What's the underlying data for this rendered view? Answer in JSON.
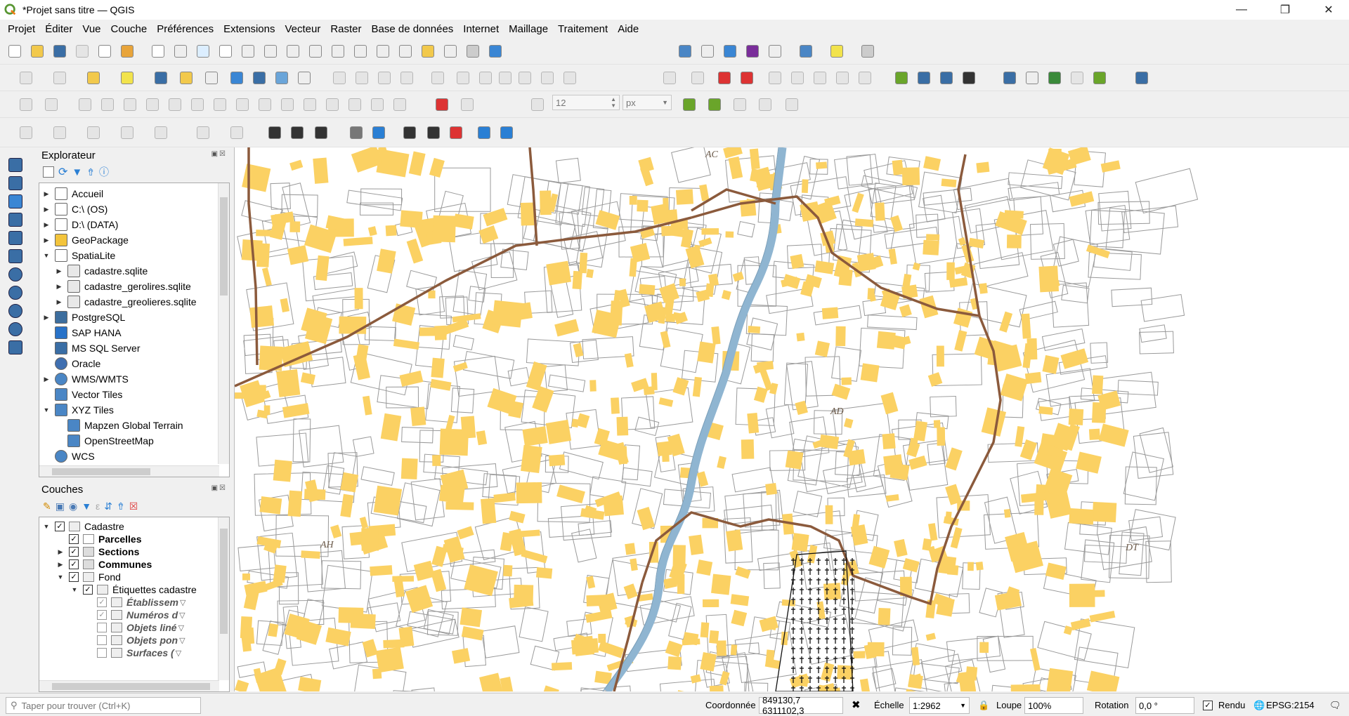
{
  "window": {
    "title": "*Projet sans titre — QGIS",
    "controls": [
      "minimize-icon",
      "maximize-icon",
      "close-icon"
    ]
  },
  "menu": [
    {
      "label": "Projet",
      "u": "P"
    },
    {
      "label": "Éditer",
      "u": "É"
    },
    {
      "label": "Vue",
      "u": "V"
    },
    {
      "label": "Couche",
      "u": "C"
    },
    {
      "label": "Préférences",
      "u": "P"
    },
    {
      "label": "Extensions",
      "u": "E"
    },
    {
      "label": "Vecteur",
      "u": "V"
    },
    {
      "label": "Raster",
      "u": "R"
    },
    {
      "label": "Base de données",
      "u": "B"
    },
    {
      "label": "Internet",
      "u": "I"
    },
    {
      "label": "Maillage",
      "u": "M"
    },
    {
      "label": "Traitement",
      "u": "T"
    },
    {
      "label": "Aide",
      "u": "A"
    }
  ],
  "snapping": {
    "tolerance": "12",
    "units": "px"
  },
  "explorer": {
    "title": "Explorateur",
    "items": [
      {
        "label": "Accueil",
        "icon": "home-icon",
        "expand": "right"
      },
      {
        "label": "C:\\ (OS)",
        "icon": "folder-icon",
        "expand": "right"
      },
      {
        "label": "D:\\ (DATA)",
        "icon": "folder-icon",
        "expand": "right"
      },
      {
        "label": "GeoPackage",
        "icon": "geopackage-icon",
        "expand": "right"
      },
      {
        "label": "SpatiaLite",
        "icon": "spatialite-icon",
        "expand": "down"
      },
      {
        "label": "cadastre.sqlite",
        "icon": "database-icon",
        "expand": "right",
        "child": true
      },
      {
        "label": "cadastre_gerolires.sqlite",
        "icon": "database-icon",
        "expand": "right",
        "child": true
      },
      {
        "label": "cadastre_greolieres.sqlite",
        "icon": "database-icon",
        "expand": "right",
        "child": true
      },
      {
        "label": "PostgreSQL",
        "icon": "postgresql-icon",
        "expand": "right"
      },
      {
        "label": "SAP HANA",
        "icon": "sap-hana-icon",
        "expand": ""
      },
      {
        "label": "MS SQL Server",
        "icon": "mssql-icon",
        "expand": ""
      },
      {
        "label": "Oracle",
        "icon": "oracle-icon",
        "expand": ""
      },
      {
        "label": "WMS/WMTS",
        "icon": "globe-icon",
        "expand": "right"
      },
      {
        "label": "Vector Tiles",
        "icon": "grid-icon",
        "expand": ""
      },
      {
        "label": "XYZ Tiles",
        "icon": "grid-icon",
        "expand": "down"
      },
      {
        "label": "Mapzen Global Terrain",
        "icon": "grid-icon",
        "expand": "",
        "child": true
      },
      {
        "label": "OpenStreetMap",
        "icon": "grid-icon",
        "expand": "",
        "child": true
      },
      {
        "label": "WCS",
        "icon": "globe-icon",
        "expand": ""
      }
    ]
  },
  "layers": {
    "title": "Couches",
    "items": [
      {
        "label": "Cadastre",
        "level": 0,
        "expand": "down",
        "checked": true,
        "icon": "group-icon",
        "style": ""
      },
      {
        "label": "Parcelles",
        "level": 1,
        "expand": "",
        "checked": true,
        "icon": "polygon-white-icon",
        "style": "bold"
      },
      {
        "label": "Sections",
        "level": 1,
        "expand": "right",
        "checked": true,
        "icon": "polygon-gray-icon",
        "style": "bold"
      },
      {
        "label": "Communes",
        "level": 1,
        "expand": "right",
        "checked": true,
        "icon": "polygon-gray-icon",
        "style": "bold"
      },
      {
        "label": "Fond",
        "level": 1,
        "expand": "down",
        "checked": true,
        "icon": "group-icon",
        "style": ""
      },
      {
        "label": "Étiquettes cadastre",
        "level": 2,
        "expand": "down",
        "checked": true,
        "icon": "group-icon",
        "style": ""
      },
      {
        "label": "Établissem",
        "level": 3,
        "expand": "",
        "checked": true,
        "icon": "label-icon",
        "style": "ital"
      },
      {
        "label": "Numéros d",
        "level": 3,
        "expand": "",
        "checked": true,
        "icon": "label-icon",
        "style": "ital"
      },
      {
        "label": "Objets liné",
        "level": 3,
        "expand": "",
        "checked": false,
        "icon": "label-icon",
        "style": "ital"
      },
      {
        "label": "Objets pon",
        "level": 3,
        "expand": "",
        "checked": false,
        "icon": "label-icon",
        "style": "ital"
      },
      {
        "label": "Surfaces (",
        "level": 3,
        "expand": "",
        "checked": false,
        "icon": "label-icon",
        "style": "ital"
      }
    ]
  },
  "map": {
    "labels": [
      "AC",
      "AD",
      "AH",
      "DT"
    ],
    "colors": {
      "building": "#fbd163",
      "river": "#8fb5d1",
      "boundary": "#8b5a3c",
      "parcel": "#9a9a9a"
    }
  },
  "status": {
    "search_placeholder": "Taper pour trouver (Ctrl+K)",
    "coord_label": "Coordonnée",
    "coord_value": "849130,7 6311102,3",
    "scale_label": "Échelle",
    "scale_value": "1:2962",
    "magnifier_label": "Loupe",
    "magnifier_value": "100%",
    "rotation_label": "Rotation",
    "rotation_value": "0,0 °",
    "render_label": "Rendu",
    "crs": "EPSG:2154"
  }
}
